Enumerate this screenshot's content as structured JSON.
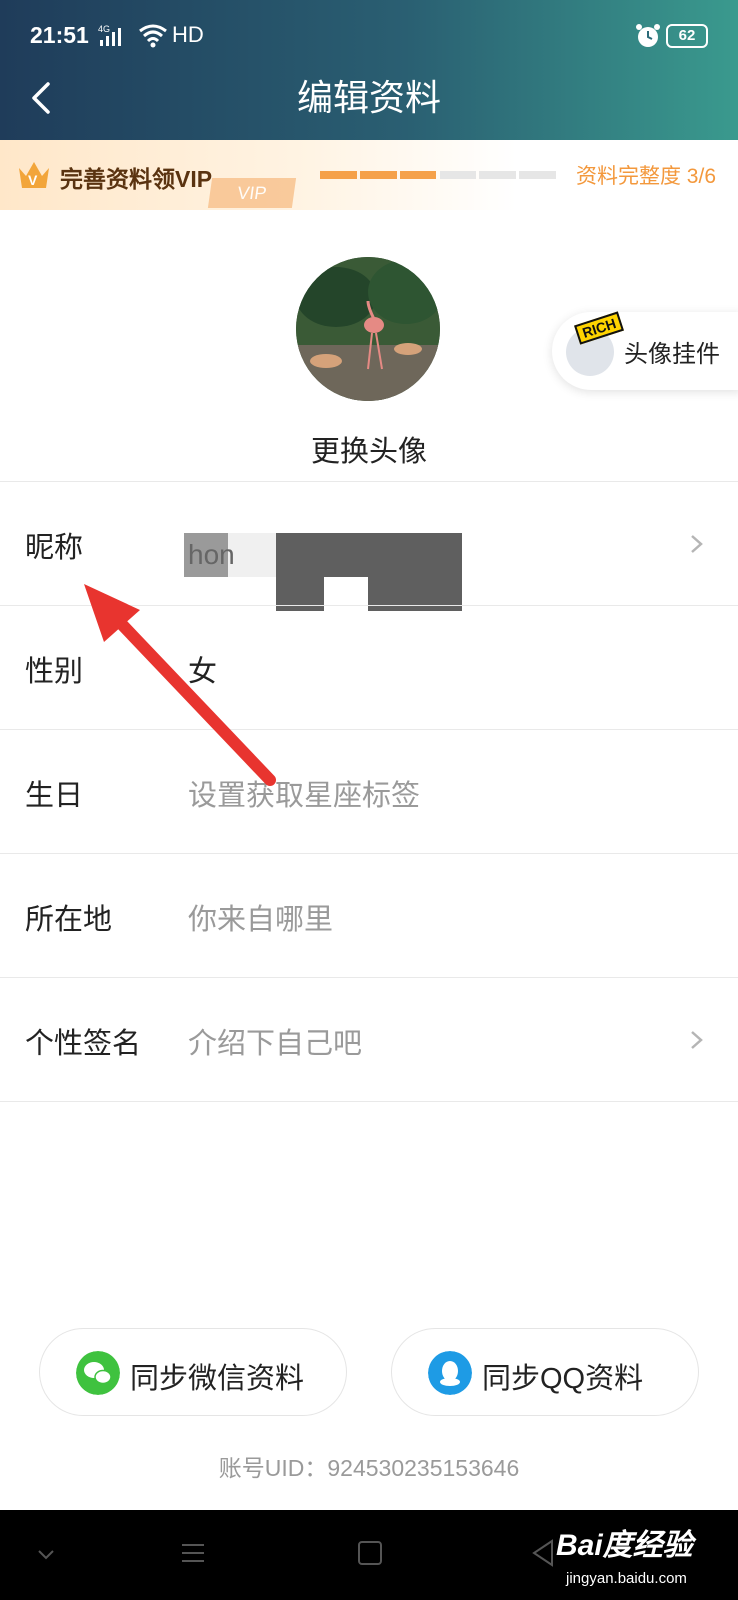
{
  "status_bar": {
    "time": "21:51",
    "network": "4G",
    "hd": "HD",
    "battery": "62",
    "signal_icon": "signal-bars-icon",
    "wifi_icon": "wifi-icon",
    "alarm_icon": "alarm-clock-icon"
  },
  "header": {
    "title": "编辑资料",
    "back_icon": "chevron-left-icon"
  },
  "vip_banner": {
    "label": "完善资料领VIP",
    "deco_text": "VIP",
    "completion": "资料完整度 3/6",
    "progress_done": 3,
    "progress_total": 6
  },
  "profile": {
    "change_avatar": "更换头像",
    "pendant_tag": "RICH",
    "pendant_label": "头像挂件"
  },
  "rows": [
    {
      "label": "昵称",
      "value": "hon",
      "has_chevron": true
    },
    {
      "label": "性别",
      "value": "女",
      "has_chevron": false
    },
    {
      "label": "生日",
      "value": "设置获取星座标签",
      "has_chevron": false
    },
    {
      "label": "所在地",
      "value": "你来自哪里",
      "has_chevron": false
    },
    {
      "label": "个性签名",
      "value": "介绍下自己吧",
      "has_chevron": true
    }
  ],
  "sync": {
    "wechat": "同步微信资料",
    "qq": "同步QQ资料"
  },
  "uid": "账号UID：924530235153646",
  "watermark": {
    "brand": "Bai度经验",
    "url": "jingyan.baidu.com"
  },
  "colors": {
    "accent_orange": "#f3983c",
    "wechat_green": "#3fc23f",
    "qq_blue": "#1e9be5",
    "arrow_red": "#e8342f"
  }
}
